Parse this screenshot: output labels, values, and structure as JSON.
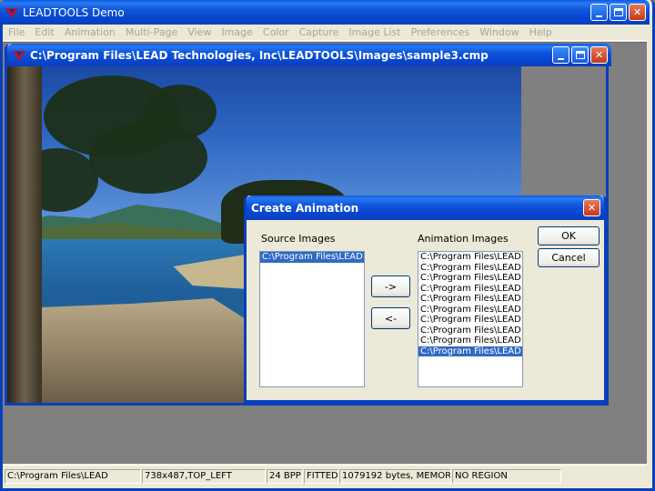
{
  "app": {
    "title": "LEADTOOLS Demo"
  },
  "menu": [
    "File",
    "Edit",
    "Animation",
    "Multi-Page",
    "View",
    "Image",
    "Color",
    "Capture",
    "Image List",
    "Preferences",
    "Window",
    "Help"
  ],
  "child_window": {
    "title": "C:\\Program Files\\LEAD Technologies, Inc\\LEADTOOLS\\Images\\sample3.cmp"
  },
  "dialog": {
    "title": "Create Animation",
    "source_label": "Source Images",
    "animation_label": "Animation Images",
    "source_items": [
      "C:\\Program Files\\LEAD Te"
    ],
    "source_selected_index": 0,
    "animation_items": [
      "C:\\Program Files\\LEAD Te",
      "C:\\Program Files\\LEAD Te",
      "C:\\Program Files\\LEAD Te",
      "C:\\Program Files\\LEAD Te",
      "C:\\Program Files\\LEAD Te",
      "C:\\Program Files\\LEAD Te",
      "C:\\Program Files\\LEAD Te",
      "C:\\Program Files\\LEAD Te",
      "C:\\Program Files\\LEAD Te",
      "C:\\Program Files\\LEAD Te"
    ],
    "animation_selected_index": 9,
    "add_button": "->",
    "remove_button": "<-",
    "ok_button": "OK",
    "cancel_button": "Cancel"
  },
  "status": {
    "path": "C:\\Program Files\\LEAD",
    "dimensions": "738x487,TOP_LEFT",
    "bpp": "24 BPP",
    "fit": "FITTED",
    "memory": "1079192 bytes, MEMORY",
    "region": "NO REGION"
  },
  "colors": {
    "title_blue": "#0a3fba",
    "selection": "#316ac5",
    "face": "#ece9d8"
  }
}
